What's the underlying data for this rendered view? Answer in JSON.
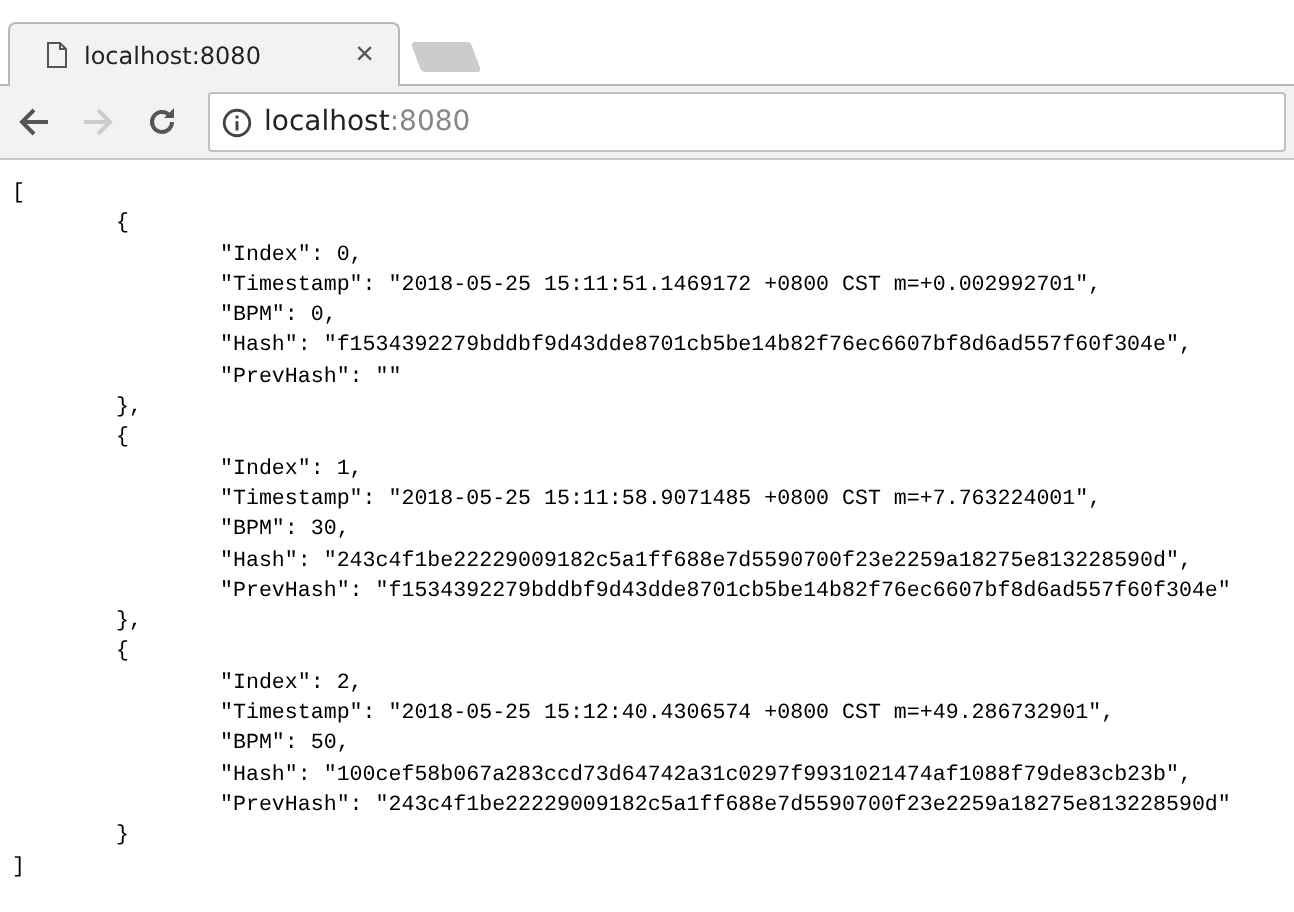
{
  "tab": {
    "title": "localhost:8080",
    "close": "×"
  },
  "address_bar": {
    "host": "localhost",
    "port": ":8080"
  },
  "document": {
    "open": "[",
    "close": "]",
    "objects": [
      {
        "open": "{",
        "close": "},",
        "fields": [
          "\"Index\": 0,",
          "\"Timestamp\": \"2018-05-25 15:11:51.1469172 +0800 CST m=+0.002992701\",",
          "\"BPM\": 0,",
          "\"Hash\": \"f1534392279bddbf9d43dde8701cb5be14b82f76ec6607bf8d6ad557f60f304e\",",
          "\"PrevHash\": \"\""
        ]
      },
      {
        "open": "{",
        "close": "},",
        "fields": [
          "\"Index\": 1,",
          "\"Timestamp\": \"2018-05-25 15:11:58.9071485 +0800 CST m=+7.763224001\",",
          "\"BPM\": 30,",
          "\"Hash\": \"243c4f1be22229009182c5a1ff688e7d5590700f23e2259a18275e813228590d\",",
          "\"PrevHash\": \"f1534392279bddbf9d43dde8701cb5be14b82f76ec6607bf8d6ad557f60f304e\""
        ]
      },
      {
        "open": "{",
        "close": "}",
        "fields": [
          "\"Index\": 2,",
          "\"Timestamp\": \"2018-05-25 15:12:40.4306574 +0800 CST m=+49.286732901\",",
          "\"BPM\": 50,",
          "\"Hash\": \"100cef58b067a283ccd73d64742a31c0297f9931021474af1088f79de83cb23b\",",
          "\"PrevHash\": \"243c4f1be22229009182c5a1ff688e7d5590700f23e2259a18275e813228590d\""
        ]
      }
    ]
  }
}
